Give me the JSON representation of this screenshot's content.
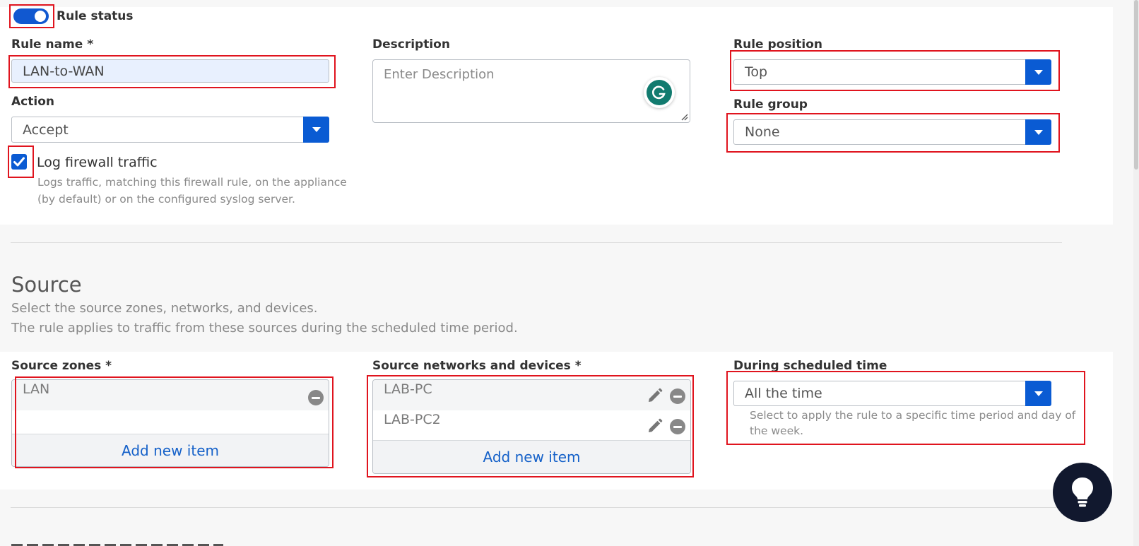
{
  "rule": {
    "status_label": "Rule status",
    "status_on": true,
    "name_label": "Rule name *",
    "name_value": "LAN-to-WAN",
    "description_label": "Description",
    "description_placeholder": "Enter Description",
    "action_label": "Action",
    "action_value": "Accept",
    "log_label": "Log firewall traffic",
    "log_checked": true,
    "log_help_line1": "Logs traffic, matching this firewall rule, on the appliance",
    "log_help_line2": "(by default) or on the configured syslog server.",
    "position_label": "Rule position",
    "position_value": "Top",
    "group_label": "Rule group",
    "group_value": "None"
  },
  "source": {
    "title": "Source",
    "desc_line1": "Select the source zones, networks, and devices.",
    "desc_line2": "The rule applies to traffic from these sources during the scheduled time period.",
    "zones_label": "Source zones *",
    "zones": [
      "LAN"
    ],
    "networks_label": "Source networks and devices *",
    "networks": [
      "LAB-PC",
      "LAB-PC2"
    ],
    "add_new_item": "Add new item",
    "schedule_label": "During scheduled time",
    "schedule_value": "All the time",
    "schedule_help_line1": "Select to apply the rule to a specific time period and day of",
    "schedule_help_line2": "the week."
  },
  "colors": {
    "accent": "#0a5bd3",
    "highlight": "#e0141e",
    "link": "#1561c9"
  }
}
